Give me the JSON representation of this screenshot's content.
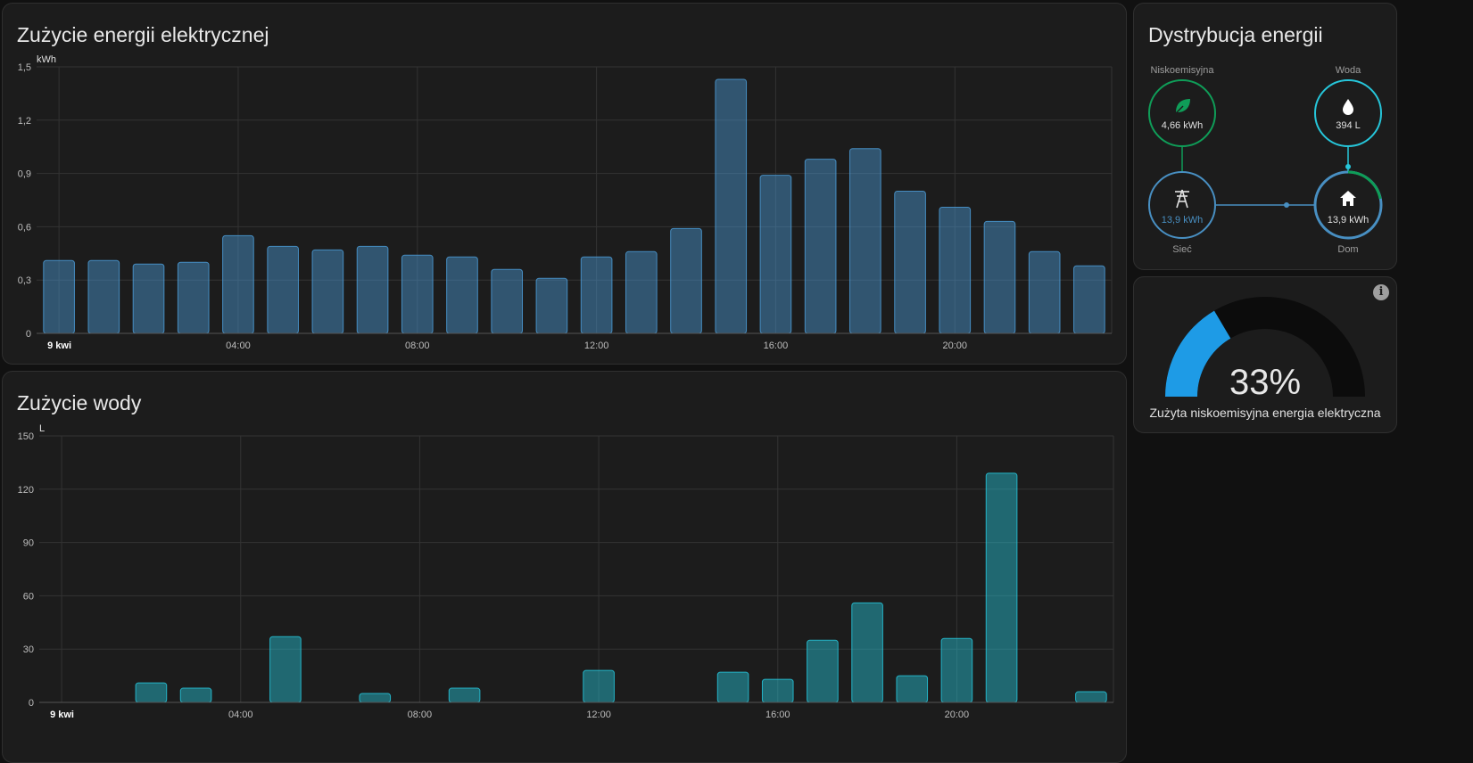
{
  "energy_card": {
    "title": "Zużycie energii elektrycznej",
    "chart_data": {
      "type": "bar",
      "unit": "kWh",
      "title": "Zużycie energii elektrycznej",
      "ylim": [
        0,
        1.5
      ],
      "y_ticks": [
        "0",
        "0,3",
        "0,6",
        "0,9",
        "1,2",
        "1,5"
      ],
      "x_labels": [
        "9 kwi",
        "04:00",
        "08:00",
        "12:00",
        "16:00",
        "20:00"
      ],
      "categories": [
        "00:00",
        "01:00",
        "02:00",
        "03:00",
        "04:00",
        "05:00",
        "06:00",
        "07:00",
        "08:00",
        "09:00",
        "10:00",
        "11:00",
        "12:00",
        "13:00",
        "14:00",
        "15:00",
        "16:00",
        "17:00",
        "18:00",
        "19:00",
        "20:00",
        "21:00",
        "22:00",
        "23:00"
      ],
      "values": [
        0.41,
        0.41,
        0.39,
        0.4,
        0.55,
        0.49,
        0.47,
        0.49,
        0.44,
        0.43,
        0.36,
        0.31,
        0.43,
        0.46,
        0.59,
        1.43,
        0.89,
        0.98,
        1.04,
        0.8,
        0.71,
        0.63,
        0.46,
        0.38
      ],
      "color": "#4b9bd6"
    }
  },
  "water_card": {
    "title": "Zużycie wody",
    "chart_data": {
      "type": "bar",
      "unit": "L",
      "title": "Zużycie wody",
      "ylim": [
        0,
        150
      ],
      "y_ticks": [
        "0",
        "30",
        "60",
        "90",
        "120",
        "150"
      ],
      "x_labels": [
        "9 kwi",
        "04:00",
        "08:00",
        "12:00",
        "16:00",
        "20:00"
      ],
      "categories": [
        "00:00",
        "01:00",
        "02:00",
        "03:00",
        "04:00",
        "05:00",
        "06:00",
        "07:00",
        "08:00",
        "09:00",
        "10:00",
        "11:00",
        "12:00",
        "13:00",
        "14:00",
        "15:00",
        "16:00",
        "17:00",
        "18:00",
        "19:00",
        "20:00",
        "21:00",
        "22:00",
        "23:00"
      ],
      "values": [
        0,
        0,
        11,
        8,
        0,
        37,
        0,
        5,
        0,
        8,
        0,
        0,
        18,
        0,
        0,
        17,
        13,
        35,
        56,
        15,
        36,
        129,
        0,
        6
      ],
      "color": "#26c6da"
    }
  },
  "distribution_card": {
    "title": "Dystrybucja energii",
    "low_carbon": {
      "label": "Niskoemisyjna",
      "value": "4,66 kWh",
      "icon": "leaf-icon",
      "color": "#0f9d58"
    },
    "water": {
      "label": "Woda",
      "value": "394 L",
      "icon": "water-drop-icon",
      "color": "#26c6da"
    },
    "grid": {
      "label": "Sieć",
      "value": "13,9 kWh",
      "icon": "transmission-tower-icon",
      "color": "#488fc2"
    },
    "home": {
      "label": "Dom",
      "value": "13,9 kWh",
      "icon": "home-icon",
      "color": "#488fc2"
    }
  },
  "gauge_card": {
    "value": "33%",
    "fraction": 0.33,
    "label": "Zużyta niskoemisyjna energia elektryczna",
    "info_icon": "information-icon",
    "fill_color": "#1e9be6",
    "track_color": "#0c0c0c"
  }
}
